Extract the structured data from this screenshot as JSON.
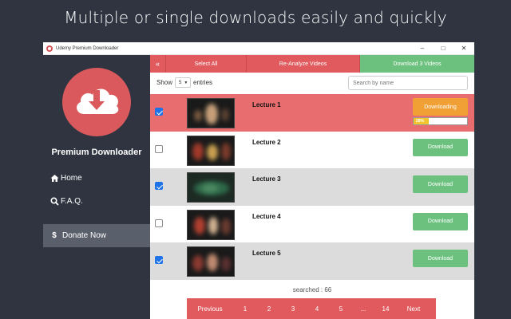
{
  "headline": "Multiple or single downloads easily and quickly",
  "window": {
    "title": "Udemy Premium Downloader",
    "controls": {
      "minimize": "–",
      "maximize": "□",
      "close": "✕"
    }
  },
  "sidebar": {
    "brand": "Premium Downloader",
    "home": "Home",
    "faq": "F.A.Q.",
    "donate": "Donate Now",
    "donate_symbol": "$"
  },
  "toolbar": {
    "collapse": "«",
    "select_all": "Select All",
    "reanalyze": "Re-Analyze Videos",
    "download": "Download 3 Videos"
  },
  "controls": {
    "show_label": "Show",
    "page_size": "5",
    "entries_label": "entries",
    "search_placeholder": "Search by name"
  },
  "rows": [
    {
      "title": "Lecture 1",
      "checked": true,
      "state": "Downloading",
      "progress_label": "28%",
      "progress": 0.28
    },
    {
      "title": "Lecture 2",
      "checked": false,
      "state": "Download"
    },
    {
      "title": "Lecture 3",
      "checked": true,
      "state": "Download"
    },
    {
      "title": "Lecture 4",
      "checked": false,
      "state": "Download"
    },
    {
      "title": "Lecture 5",
      "checked": true,
      "state": "Download"
    }
  ],
  "footer": {
    "searched": "searched : 66",
    "pagination": {
      "prev": "Previous",
      "pages": [
        "1",
        "2",
        "3",
        "4",
        "5"
      ],
      "ellipsis": "...",
      "last": "14",
      "next": "Next"
    }
  },
  "colors": {
    "accent_red": "#e05a5e",
    "accent_green": "#6cc17e",
    "downloading_orange": "#f0a034",
    "sidebar_bg": "#2f3440"
  }
}
